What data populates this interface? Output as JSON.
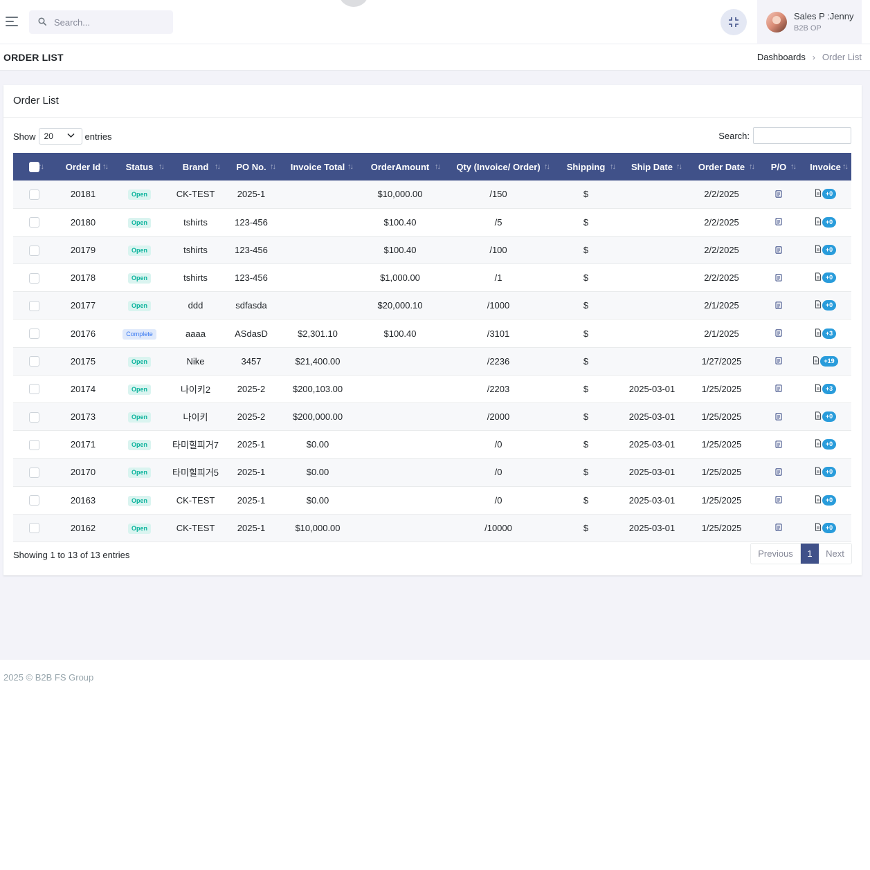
{
  "header": {
    "search_placeholder": "Search...",
    "user_name": "Sales P :Jenny",
    "user_role": "B2B OP"
  },
  "page": {
    "title": "ORDER LIST",
    "breadcrumb": [
      "Dashboards",
      "Order List"
    ]
  },
  "card": {
    "title": "Order List",
    "show_label": "Show",
    "entries_label": "entries",
    "page_length": "20",
    "search_label": "Search:"
  },
  "table": {
    "columns": [
      "Order Id",
      "Status",
      "Brand",
      "PO No.",
      "Invoice Total",
      "OrderAmount",
      "Qty (Invoice/ Order)",
      "Shipping",
      "Ship Date",
      "Order Date",
      "P/O",
      "Invoice"
    ],
    "rows": [
      {
        "order_id": "20181",
        "status": "Open",
        "brand": "CK-TEST",
        "po_no": "2025-1",
        "invoice_total": "",
        "order_amount": "$10,000.00",
        "qty": "/150",
        "shipping": "$",
        "ship_date": "",
        "order_date": "2/2/2025",
        "invoice_count": "+0"
      },
      {
        "order_id": "20180",
        "status": "Open",
        "brand": "tshirts",
        "po_no": "123-456",
        "invoice_total": "",
        "order_amount": "$100.40",
        "qty": "/5",
        "shipping": "$",
        "ship_date": "",
        "order_date": "2/2/2025",
        "invoice_count": "+0"
      },
      {
        "order_id": "20179",
        "status": "Open",
        "brand": "tshirts",
        "po_no": "123-456",
        "invoice_total": "",
        "order_amount": "$100.40",
        "qty": "/100",
        "shipping": "$",
        "ship_date": "",
        "order_date": "2/2/2025",
        "invoice_count": "+0"
      },
      {
        "order_id": "20178",
        "status": "Open",
        "brand": "tshirts",
        "po_no": "123-456",
        "invoice_total": "",
        "order_amount": "$1,000.00",
        "qty": "/1",
        "shipping": "$",
        "ship_date": "",
        "order_date": "2/2/2025",
        "invoice_count": "+0"
      },
      {
        "order_id": "20177",
        "status": "Open",
        "brand": "ddd",
        "po_no": "sdfasda",
        "invoice_total": "",
        "order_amount": "$20,000.10",
        "qty": "/1000",
        "shipping": "$",
        "ship_date": "",
        "order_date": "2/1/2025",
        "invoice_count": "+0"
      },
      {
        "order_id": "20176",
        "status": "Complete",
        "brand": "aaaa",
        "po_no": "ASdasD",
        "invoice_total": "$2,301.10",
        "order_amount": "$100.40",
        "qty": "/3101",
        "shipping": "$",
        "ship_date": "",
        "order_date": "2/1/2025",
        "invoice_count": "+3"
      },
      {
        "order_id": "20175",
        "status": "Open",
        "brand": "Nike",
        "po_no": "3457",
        "invoice_total": "$21,400.00",
        "order_amount": "",
        "qty": "/2236",
        "shipping": "$",
        "ship_date": "",
        "order_date": "1/27/2025",
        "invoice_count": "+19"
      },
      {
        "order_id": "20174",
        "status": "Open",
        "brand": "나이키2",
        "po_no": "2025-2",
        "invoice_total": "$200,103.00",
        "order_amount": "",
        "qty": "/2203",
        "shipping": "$",
        "ship_date": "2025-03-01",
        "order_date": "1/25/2025",
        "invoice_count": "+3"
      },
      {
        "order_id": "20173",
        "status": "Open",
        "brand": "나이키",
        "po_no": "2025-2",
        "invoice_total": "$200,000.00",
        "order_amount": "",
        "qty": "/2000",
        "shipping": "$",
        "ship_date": "2025-03-01",
        "order_date": "1/25/2025",
        "invoice_count": "+0"
      },
      {
        "order_id": "20171",
        "status": "Open",
        "brand": "타미힐피거7",
        "po_no": "2025-1",
        "invoice_total": "$0.00",
        "order_amount": "",
        "qty": "/0",
        "shipping": "$",
        "ship_date": "2025-03-01",
        "order_date": "1/25/2025",
        "invoice_count": "+0"
      },
      {
        "order_id": "20170",
        "status": "Open",
        "brand": "타미힐피거5",
        "po_no": "2025-1",
        "invoice_total": "$0.00",
        "order_amount": "",
        "qty": "/0",
        "shipping": "$",
        "ship_date": "2025-03-01",
        "order_date": "1/25/2025",
        "invoice_count": "+0"
      },
      {
        "order_id": "20163",
        "status": "Open",
        "brand": "CK-TEST",
        "po_no": "2025-1",
        "invoice_total": "$0.00",
        "order_amount": "",
        "qty": "/0",
        "shipping": "$",
        "ship_date": "2025-03-01",
        "order_date": "1/25/2025",
        "invoice_count": "+0"
      },
      {
        "order_id": "20162",
        "status": "Open",
        "brand": "CK-TEST",
        "po_no": "2025-1",
        "invoice_total": "$10,000.00",
        "order_amount": "",
        "qty": "/10000",
        "shipping": "$",
        "ship_date": "2025-03-01",
        "order_date": "1/25/2025",
        "invoice_count": "+0"
      }
    ]
  },
  "pagination": {
    "info": "Showing 1 to 13 of 13 entries",
    "previous": "Previous",
    "current": "1",
    "next": "Next"
  },
  "footer": {
    "text": "2025 © B2B FS Group"
  },
  "colors": {
    "primary": "#405189",
    "open_badge": "#0ab39c",
    "complete_badge": "#3577f1",
    "count_badge": "#299cdb"
  }
}
